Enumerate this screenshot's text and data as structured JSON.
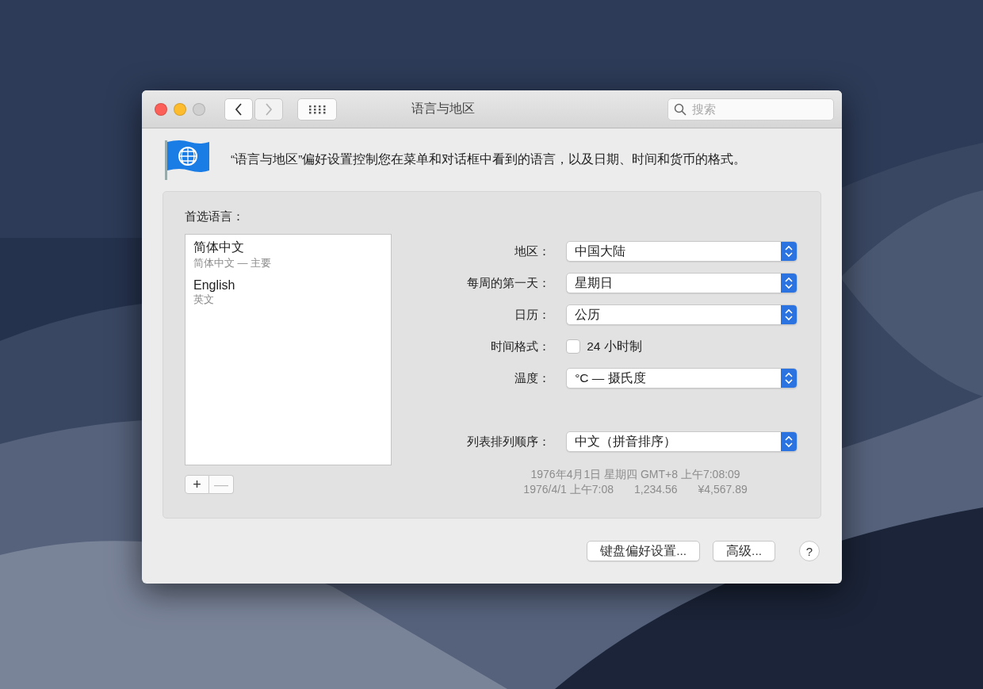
{
  "window": {
    "title": "语言与地区",
    "search": {
      "placeholder": "搜索"
    },
    "nav": [
      {
        "kind": "back",
        "disabled": false
      },
      {
        "kind": "forward",
        "disabled": true
      }
    ]
  },
  "description": "“语言与地区”偏好设置控制您在菜单和对话框中看到的语言，以及日期、时间和货币的格式。",
  "languages": {
    "label": "首选语言：",
    "items": [
      {
        "name": "简体中文",
        "detail": "简体中文 — 主要"
      },
      {
        "name": "English",
        "detail": "英文"
      }
    ],
    "buttons": [
      {
        "label": "+",
        "disabled": false
      },
      {
        "label": "—",
        "disabled": true
      }
    ]
  },
  "settings": [
    {
      "kind": "popup",
      "label": "地区：",
      "value": "中国大陆"
    },
    {
      "kind": "popup",
      "label": "每周的第一天：",
      "value": "星期日"
    },
    {
      "kind": "popup",
      "label": "日历：",
      "value": "公历"
    },
    {
      "kind": "checkbox",
      "label": "时间格式：",
      "value": "24 小时制",
      "checked": false
    },
    {
      "kind": "popup",
      "label": "温度：",
      "value": "°C — 摄氏度"
    }
  ],
  "list_sort": {
    "label": "列表排列顺序：",
    "value": "中文（拼音排序）"
  },
  "samples": {
    "line_1": "1976年4月1日 星期四 GMT+8 上午7:08:09",
    "line_2": [
      "1976/4/1 上午7:08",
      "1,234.56",
      "¥4,567.89"
    ]
  },
  "buttons": [
    "键盘偏好设置...",
    "高级...",
    "?"
  ]
}
